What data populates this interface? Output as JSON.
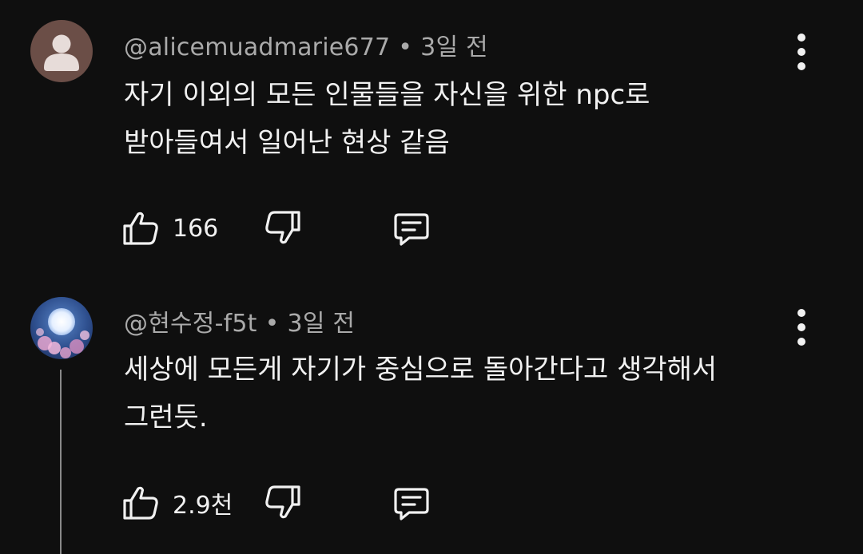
{
  "comments": [
    {
      "author": "@alicemuadmarie677",
      "separator": "•",
      "time": "3일 전",
      "text_lines": [
        "자기 이외의 모든 인물들을 자신을 위한 npc로",
        "받아들여서 일어난 현상 같음"
      ],
      "likes": "166",
      "avatar_type": "default-person"
    },
    {
      "author": "@현수정-f5t",
      "separator": "•",
      "time": "3일 전",
      "text_lines": [
        "세상에 모든게 자기가 중심으로 돌아간다고 생각해서",
        "그런듯."
      ],
      "likes": "2.9천",
      "avatar_type": "moon-blossom-image",
      "has_replies_thread": true
    }
  ],
  "icons": {
    "like": "thumbs-up-icon",
    "dislike": "thumbs-down-icon",
    "reply": "comment-reply-icon",
    "more": "more-vertical-icon"
  },
  "colors": {
    "background": "#0f0f0f",
    "primary_text": "#f1f1f1",
    "secondary_text": "#aaaaaa",
    "default_avatar": "#6b4e47"
  }
}
